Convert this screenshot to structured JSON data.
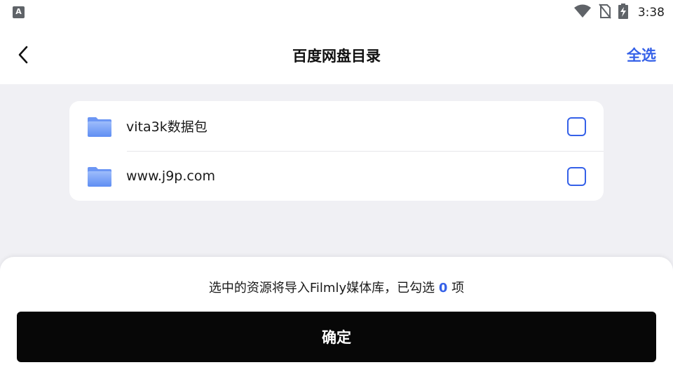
{
  "status_bar": {
    "app_icon_letter": "A",
    "time": "3:38",
    "icons": [
      "wifi-icon",
      "no-sim-icon",
      "battery-charging-icon"
    ]
  },
  "header": {
    "title": "百度网盘目录",
    "select_all_label": "全选",
    "back_icon": "chevron-left-icon"
  },
  "list": {
    "items": [
      {
        "label": "vita3k数据包",
        "icon": "folder-icon",
        "checked": false
      },
      {
        "label": "www.j9p.com",
        "icon": "folder-icon",
        "checked": false
      }
    ]
  },
  "sheet": {
    "info_prefix": "选中的资源将导入Filmly媒体库，已勾选",
    "count": "0",
    "info_suffix": "项",
    "confirm_label": "确定"
  },
  "colors": {
    "accent": "#3561e8",
    "confirm_bg": "#070707",
    "page_bg": "#f0f0f4",
    "folder": "#7aa4f7"
  }
}
